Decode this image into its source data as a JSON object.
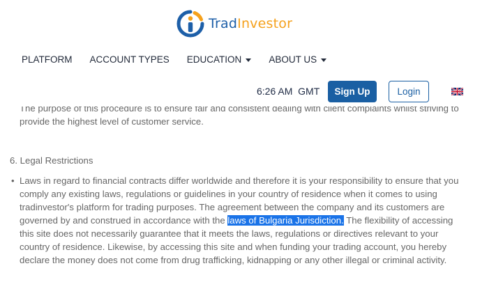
{
  "logo": {
    "brand_part1": "Trad",
    "brand_part2": "Investor",
    "icon": "logo-i-icon",
    "colors": {
      "blue": "#1d5fa8",
      "orange": "#f5a11c"
    }
  },
  "nav": {
    "items": [
      {
        "label": "PLATFORM",
        "dropdown": false
      },
      {
        "label": "ACCOUNT TYPES",
        "dropdown": false
      },
      {
        "label": "EDUCATION",
        "dropdown": true
      },
      {
        "label": "ABOUT US",
        "dropdown": true
      }
    ]
  },
  "header": {
    "time": "6:26 AM",
    "timezone": "GMT",
    "signup_label": "Sign Up",
    "login_label": "Login",
    "language_icon": "uk-flag-icon"
  },
  "content": {
    "partial_line_1": "The purpose of this procedure is to ensure fair and consistent dealing with client complaints whilst striving to",
    "partial_line_2": "provide the highest level of customer service.",
    "section_heading": "6. Legal Restrictions",
    "bullet_before": "Laws in regard to financial contracts differ worldwide and therefore it is your responsibility to ensure that you comply any existing laws, regulations or guidelines in your country of residence when it comes to using tradinvestor's platform for trading purposes. The agreement between the company and its customers are governed by and construed in accordance with the ",
    "bullet_highlight": "laws of Bulgaria Jurisdiction.",
    "bullet_after": " The flexibility of accessing this site does not necessarily guarantee that it meets the laws, regulations or directives relevant to your country of residence. Likewise, by accessing this site and when funding your trading account, you hereby declare the money does not come from drug trafficking, kidnapping or any other illegal or criminal activity.",
    "bullet_symbol": "•",
    "highlight_color": "#1a73e8"
  }
}
